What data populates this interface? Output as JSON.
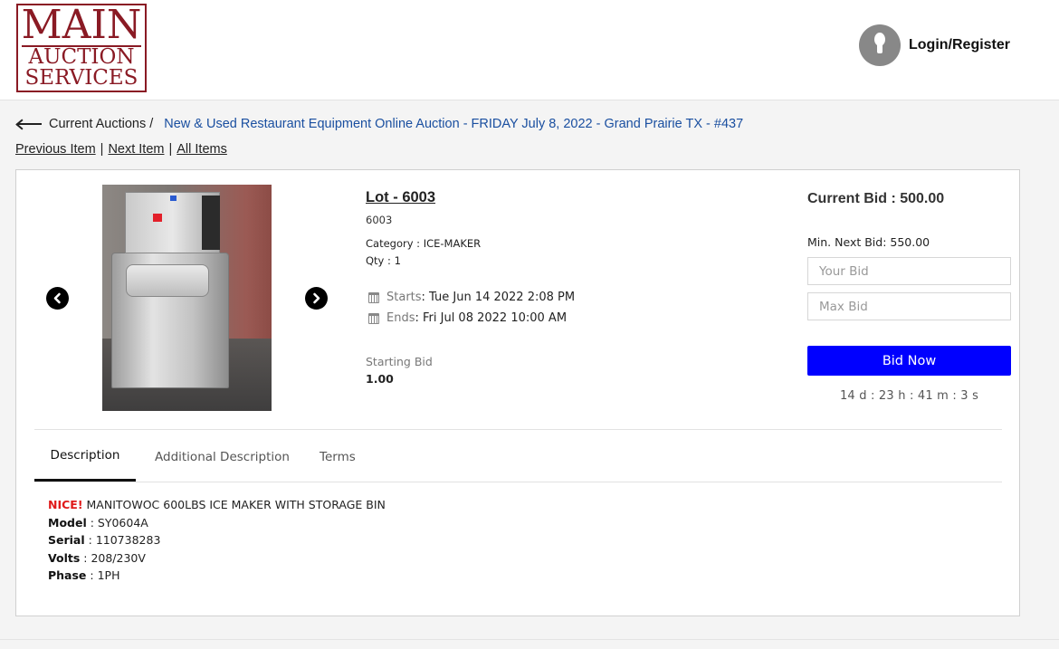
{
  "header": {
    "logo": {
      "line1": "MAIN",
      "line2": "AUCTION",
      "line3": "SERVICES"
    },
    "login_label": "Login/Register"
  },
  "breadcrumb": {
    "current": "Current Auctions",
    "separator": "/",
    "auction": "New & Used Restaurant Equipment Online Auction - FRIDAY July 8, 2022 - Grand Prairie TX - #437"
  },
  "nav": {
    "previous": "Previous Item",
    "next": "Next Item",
    "all": "All Items",
    "pipe": "|"
  },
  "lot": {
    "title": "Lot - 6003",
    "number": "6003",
    "category_label": "Category :",
    "category": "ICE-MAKER",
    "qty_label": "Qty :",
    "qty": "1",
    "starts_label": "Starts",
    "starts": ": Tue Jun 14 2022 2:08 PM",
    "ends_label": "Ends",
    "ends": ": Fri Jul 08 2022 10:00 AM",
    "starting_bid_label": "Starting Bid",
    "starting_bid": "1.00"
  },
  "bid": {
    "current_label": "Current Bid : 500.00",
    "min_next": "Min. Next Bid: 550.00",
    "your_bid_placeholder": "Your Bid",
    "max_bid_placeholder": "Max Bid",
    "button": "Bid Now",
    "countdown": "14 d : 23 h : 41 m : 3 s"
  },
  "tabs": [
    {
      "label": "Description",
      "active": true
    },
    {
      "label": "Additional Description",
      "active": false
    },
    {
      "label": "Terms",
      "active": false
    }
  ],
  "description": {
    "nice": "NICE!",
    "headline": "MANITOWOC 600LBS ICE MAKER WITH STORAGE BIN",
    "fields": [
      {
        "key": "Model",
        "value": " : SY0604A"
      },
      {
        "key": "Serial",
        "value": " : 110738283"
      },
      {
        "key": "Volts",
        "value": " : 208/230V"
      },
      {
        "key": "Phase",
        "value": " : 1PH"
      }
    ]
  },
  "icons": {
    "back": "arrow-left-icon",
    "user": "user-icon",
    "calendar": "calendar-icon",
    "prev": "chevron-left-circle-icon",
    "next": "chevron-right-circle-icon"
  },
  "colors": {
    "brand": "#8a1a24",
    "link": "#1a4fa0",
    "bid_button": "#0000ff",
    "nice": "#e01a1a"
  }
}
